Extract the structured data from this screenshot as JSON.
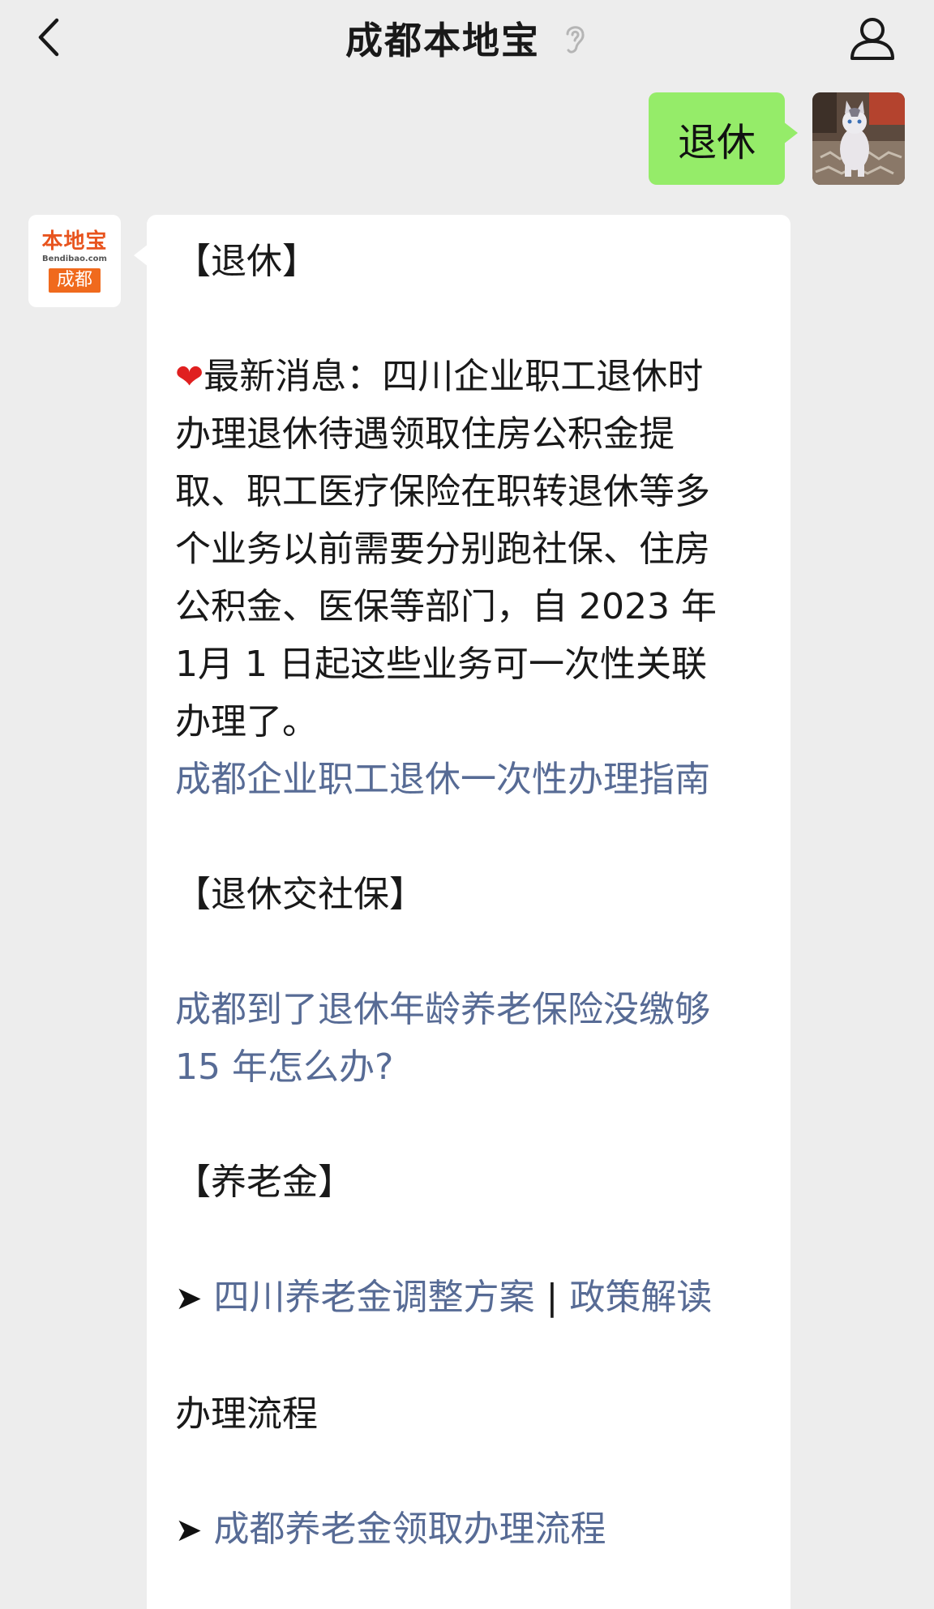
{
  "header": {
    "title": "成都本地宝",
    "back_icon": "chevron-left-icon",
    "ear_icon": "ear-icon",
    "profile_icon": "person-icon"
  },
  "user_message": {
    "text": "退休"
  },
  "bot_avatar": {
    "logo_text": "本地宝",
    "logo_sub": "Bendibao.com",
    "logo_city": "成都"
  },
  "bot_message": {
    "heading_retire": "【退休】",
    "news_lines": [
      "最新消息：四川企业职工退休时",
      "办理退休待遇领取住房公积金提",
      "取、职工医疗保险在职转退休等多",
      "个业务以前需要分别跑社保、住房",
      "公积金、医保等部门，自 2023 年",
      "1月 1 日起这些业务可一次性关联",
      "办理了。"
    ],
    "link_guide": "成都企业职工退休一次性办理指南",
    "heading_social": "【退休交社保】",
    "link_social_1": "成都到了退休年龄养老保险没缴够",
    "link_social_2": "15 年怎么办?",
    "heading_pension": "【养老金】",
    "arrow": "➤",
    "link_pension_plan": "四川养老金调整方案",
    "separator": "|",
    "link_policy": "政策解读",
    "process_label": "办理流程",
    "link_process": "成都养老金领取办理流程"
  }
}
